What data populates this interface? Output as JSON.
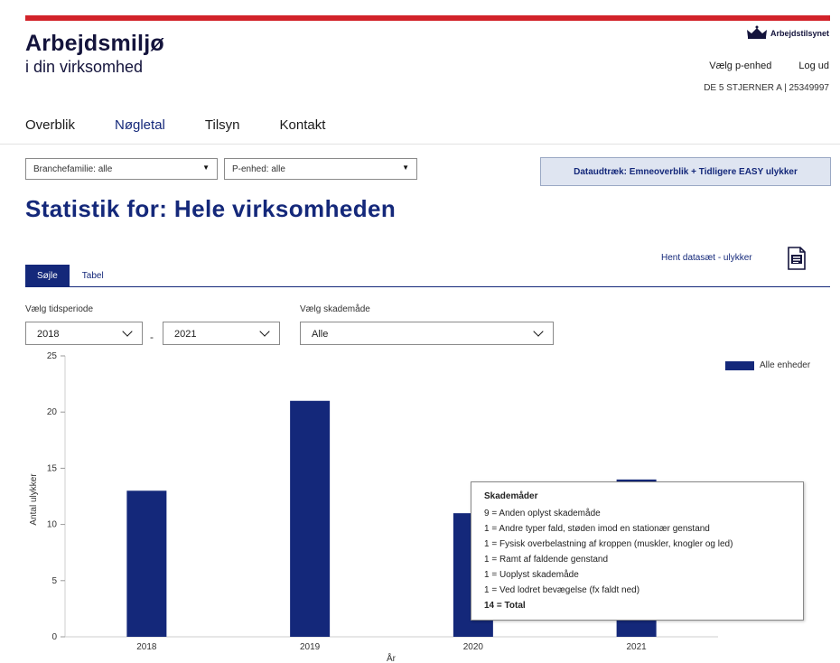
{
  "header": {
    "title_line1": "Arbejdsmiljø",
    "title_line2": "i din virksomhed",
    "brand": "Arbejdstilsynet",
    "links": {
      "choose_unit": "Vælg p-enhed",
      "logout": "Log ud"
    },
    "company": "DE 5 STJERNER A | 25349997",
    "colors": {
      "accent": "#d2232a",
      "brand": "#14287a"
    }
  },
  "nav": {
    "items": [
      {
        "label": "Overblik"
      },
      {
        "label": "Nøgletal"
      },
      {
        "label": "Tilsyn"
      },
      {
        "label": "Kontakt"
      }
    ],
    "active": "Nøgletal"
  },
  "filters": {
    "branch": "Branchefamilie: alle",
    "unit": "P-enhed: alle",
    "extract_button": "Dataudtræk: Emneoverblik + Tidligere EASY ulykker"
  },
  "page_title": "Statistik for: Hele virksomheden",
  "dataset_link": "Hent datasæt - ulykker",
  "tabs": [
    {
      "label": "Søjle"
    },
    {
      "label": "Tabel"
    }
  ],
  "period": {
    "label": "Vælg tidsperiode",
    "from": "2018",
    "separator": "-",
    "to": "2021"
  },
  "damage_mode": {
    "label": "Vælg skademåde",
    "value": "Alle"
  },
  "chart_data": {
    "type": "bar",
    "categories": [
      "2018",
      "2019",
      "2020",
      "2021"
    ],
    "series": [
      {
        "name": "Alle enheder",
        "values": [
          13,
          21,
          11,
          14
        ]
      }
    ],
    "xlabel": "År",
    "ylabel": "Antal ulykker",
    "ylim": [
      0,
      25
    ],
    "yticks": [
      0,
      5,
      10,
      15,
      20,
      25
    ],
    "grid": false,
    "legend": "top-right",
    "color": "#14287a"
  },
  "tooltip": {
    "title": "Skademåder",
    "lines": [
      "9 = Anden oplyst skademåde",
      "1 = Andre typer fald, støden imod en stationær genstand",
      "1 = Fysisk overbelastning af kroppen (muskler, knogler og led)",
      "1 = Ramt af faldende genstand",
      "1 = Uoplyst skademåde",
      "1 = Ved lodret bevægelse (fx faldt ned)"
    ],
    "total": "14 = Total"
  }
}
